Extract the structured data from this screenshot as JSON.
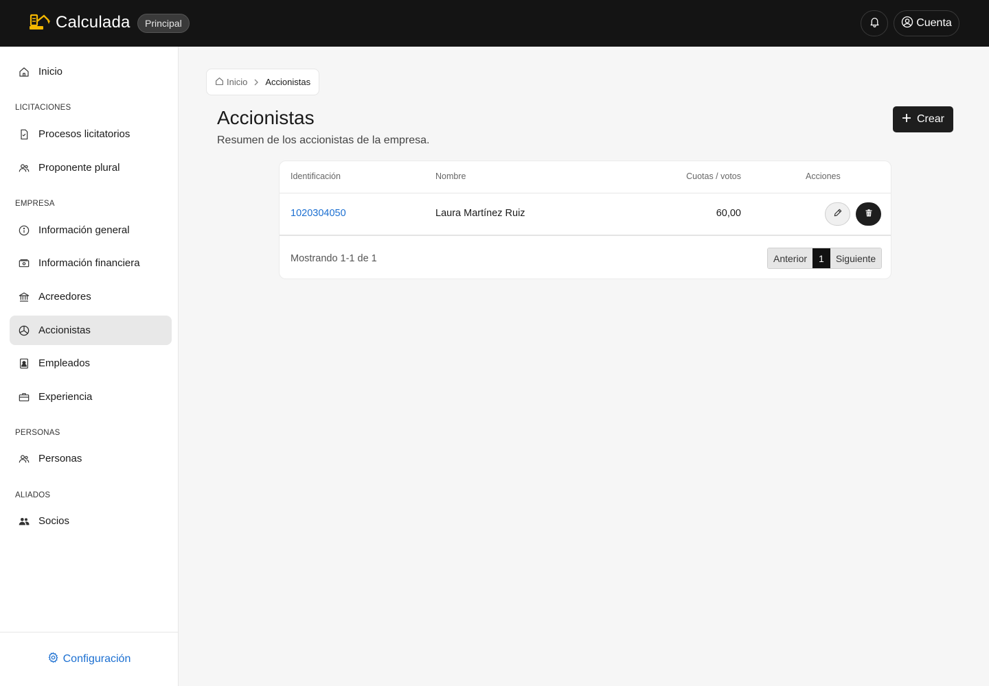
{
  "app": {
    "name": "Calculada",
    "badge": "Principal",
    "account_label": "Cuenta",
    "logo_icon": "excavator-icon",
    "accent_color": "#f5b800"
  },
  "sidebar": {
    "home": "Inicio",
    "sections": {
      "licitaciones": "LICITACIONES",
      "empresa": "EMPRESA",
      "personas": "PERSONAS",
      "aliados": "ALIADOS"
    },
    "items": {
      "procesos": "Procesos licitatorios",
      "proponente": "Proponente plural",
      "info_general": "Información general",
      "info_financiera": "Información financiera",
      "acreedores": "Acreedores",
      "accionistas": "Accionistas",
      "empleados": "Empleados",
      "experiencia": "Experiencia",
      "personas": "Personas",
      "socios": "Socios"
    },
    "active": "accionistas",
    "settings": "Configuración"
  },
  "breadcrumb": {
    "home": "Inicio",
    "current": "Accionistas"
  },
  "page": {
    "title": "Accionistas",
    "subtitle": "Resumen de los accionistas de la empresa.",
    "create_label": "Crear"
  },
  "table": {
    "headers": {
      "id": "Identificación",
      "name": "Nombre",
      "shares": "Cuotas / votos",
      "actions": "Acciones"
    },
    "rows": [
      {
        "id": "1020304050",
        "name": "Laura Martínez Ruiz",
        "shares": "60,00"
      }
    ],
    "footer_text": "Mostrando 1-1 de 1",
    "pagination": {
      "prev": "Anterior",
      "current": "1",
      "next": "Siguiente"
    }
  }
}
